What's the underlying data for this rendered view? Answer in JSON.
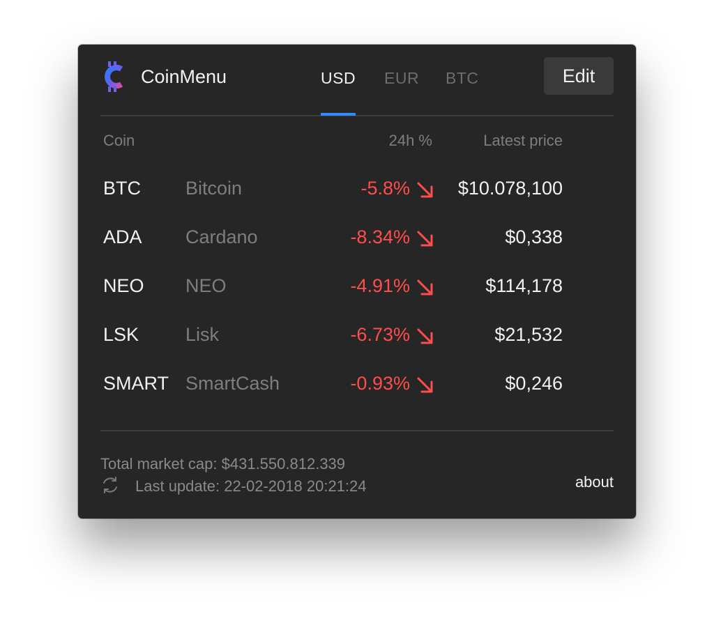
{
  "app": {
    "name": "CoinMenu",
    "accent_color": "#2f8bff",
    "logo_icon": "coin-menu-logo"
  },
  "tabs": [
    {
      "label": "USD",
      "active": true
    },
    {
      "label": "EUR",
      "active": false
    },
    {
      "label": "BTC",
      "active": false
    }
  ],
  "edit_label": "Edit",
  "table": {
    "headers": {
      "coin": "Coin",
      "change": "24h %",
      "price": "Latest price"
    },
    "rows": [
      {
        "symbol": "BTC",
        "name": "Bitcoin",
        "change": "-5.8%",
        "trend_icon": "arrow-down-right-icon",
        "price": "$10.078,100"
      },
      {
        "symbol": "ADA",
        "name": "Cardano",
        "change": "-8.34%",
        "trend_icon": "arrow-down-right-icon",
        "price": "$0,338"
      },
      {
        "symbol": "NEO",
        "name": "NEO",
        "change": "-4.91%",
        "trend_icon": "arrow-down-right-icon",
        "price": "$114,178"
      },
      {
        "symbol": "LSK",
        "name": "Lisk",
        "change": "-6.73%",
        "trend_icon": "arrow-down-right-icon",
        "price": "$21,532"
      },
      {
        "symbol": "SMART",
        "name": "SmartCash",
        "change": "-0.93%",
        "trend_icon": "arrow-down-right-icon",
        "price": "$0,246"
      }
    ],
    "negative_color": "#ff4d4d"
  },
  "footer": {
    "market_cap": "Total market cap: $431.550.812.339",
    "last_update": "Last update: 22-02-2018 20:21:24",
    "refresh_icon": "refresh-icon",
    "about_label": "about"
  }
}
